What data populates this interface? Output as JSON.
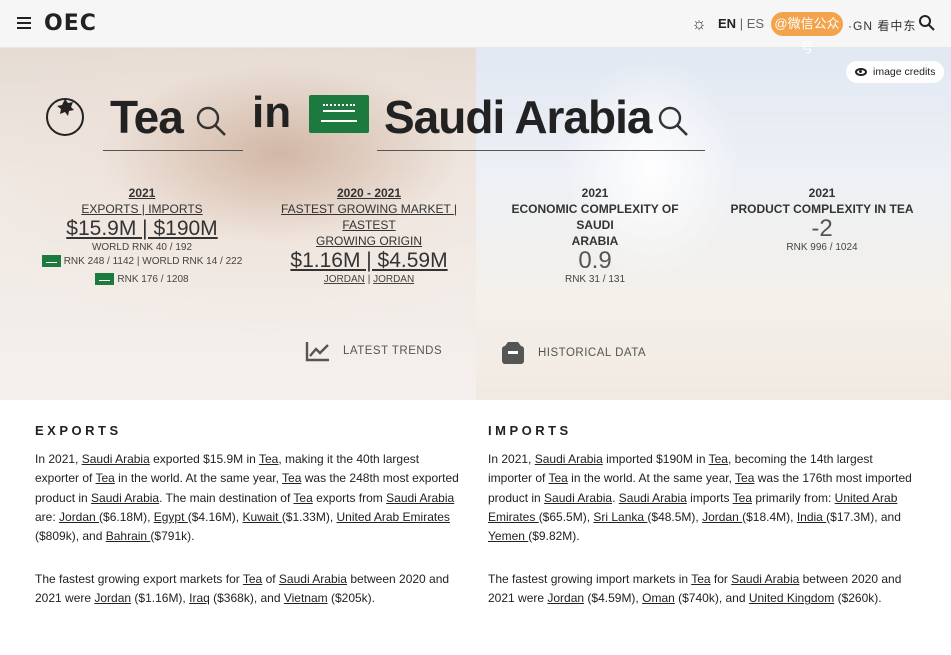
{
  "header": {
    "logo": "OEC",
    "lang_active": "EN",
    "lang_separator": "|",
    "lang_inactive": "ES",
    "signin_button": "@微信公众号",
    "signin_overlay": "·GN 看中东",
    "icons": [
      "menu-icon",
      "sun-icon",
      "search-icon"
    ]
  },
  "hero": {
    "image_credits": "image credits",
    "product": "Tea",
    "connector": "in",
    "country": "Saudi Arabia",
    "colors": {
      "flag_green": "#1c7a3e",
      "signin_orange": "#f3a34b"
    }
  },
  "stats": {
    "trade": {
      "year": "2021",
      "label": "EXPORTS | IMPORTS",
      "value": "$15.9M | $190M",
      "world_rank": "WORLD RNK 40 / 192",
      "country_rank": "RNK 248 / 1142 | WORLD RNK 14 / 222",
      "country_rank_2": "RNK 176 / 1208"
    },
    "growth": {
      "year": "2020 - 2021",
      "label_line1": "FASTEST GROWING MARKET | FASTEST",
      "label_line2": "GROWING ORIGIN",
      "value": "$1.16M | $4.59M",
      "market": "JORDAN",
      "separator": "|",
      "origin": "JORDAN"
    },
    "eci": {
      "year": "2021",
      "label_line1": "ECONOMIC COMPLEXITY OF SAUDI",
      "label_line2": "ARABIA",
      "value": "0.9",
      "rank": "RNK 31 / 131"
    },
    "pci": {
      "year": "2021",
      "label": "PRODUCT COMPLEXITY IN TEA",
      "value": "-2",
      "rank": "RNK 996 / 1024"
    }
  },
  "buttons": {
    "latest_trends": "LATEST TRENDS",
    "historical_data": "HISTORICAL DATA"
  },
  "exports": {
    "title": "EXPORTS",
    "p1": {
      "t1": "In 2021, ",
      "l1": "Saudi Arabia",
      "t2": " exported $15.9M in ",
      "l2": "Tea",
      "t3": ", making it the 40th largest exporter of ",
      "l3": "Tea",
      "t4": " in the world. At the same year, ",
      "l4": "Tea",
      "t5": " was the 248th most exported product in ",
      "l5": "Saudi Arabia",
      "t6": ". The main destination of ",
      "l6": "Tea",
      "t7": " exports from ",
      "l7": "Saudi Arabia",
      "t8": " are: ",
      "d1": "Jordan ",
      "v1": "($6.18M), ",
      "d2": "Egypt ",
      "v2": "($4.16M), ",
      "d3": "Kuwait ",
      "v3": "($1.33M), ",
      "d4": "United Arab Emirates ",
      "v4": "($809k), and ",
      "d5": "Bahrain ",
      "v5": "($791k)."
    },
    "p2": {
      "t1": "The fastest growing export markets for ",
      "l1": "Tea",
      "t2": " of ",
      "l2": "Saudi Arabia",
      "t3": " between 2020 and 2021 were ",
      "d1": "Jordan",
      "v1": " ($1.16M), ",
      "d2": "Iraq",
      "v2": " ($368k), and ",
      "d3": "Vietnam",
      "v3": " ($205k)."
    }
  },
  "imports": {
    "title": "IMPORTS",
    "p1": {
      "t1": "In 2021, ",
      "l1": "Saudi Arabia",
      "t2": " imported $190M in ",
      "l2": "Tea",
      "t3": ", becoming the 14th largest importer of ",
      "l3": "Tea",
      "t4": " in the world. At the same year, ",
      "l4": "Tea",
      "t5": " was the 176th most imported product in ",
      "l5": "Saudi Arabia",
      "t6": ". ",
      "l6": "Saudi Arabia",
      "t7": " imports ",
      "l7": "Tea",
      "t8": " primarily from: ",
      "d1": "United Arab Emirates ",
      "v1": "($65.5M), ",
      "d2": "Sri Lanka ",
      "v2": "($48.5M), ",
      "d3": "Jordan ",
      "v3": "($18.4M), ",
      "d4": "India ",
      "v4": "($17.3M), and ",
      "d5": "Yemen ",
      "v5": "($9.82M)."
    },
    "p2": {
      "t1": "The fastest growing import markets in ",
      "l1": "Tea",
      "t2": " for ",
      "l2": "Saudi Arabia",
      "t3": " between 2020 and 2021 were ",
      "d1": "Jordan",
      "v1": " ($4.59M), ",
      "d2": "Oman",
      "v2": " ($740k), and ",
      "d3": "United Kingdom",
      "v3": " ($260k)."
    }
  }
}
